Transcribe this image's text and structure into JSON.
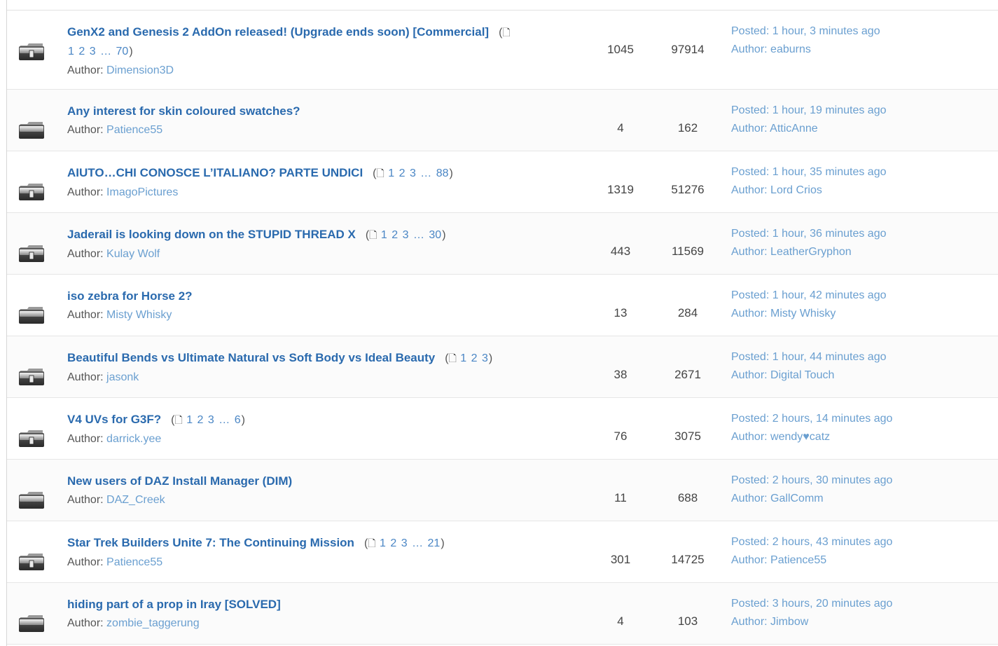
{
  "topics": [
    {
      "title": "GenX2 and Genesis 2 AddOn released! (Upgrade ends soon) [Commercial]",
      "pages": [
        "1",
        "2",
        "3",
        "…",
        "70"
      ],
      "author_label": "Author:",
      "author": "Dimension3D",
      "replies": "1045",
      "views": "97914",
      "posted_label": "Posted:",
      "posted": "1 hour, 3 minutes ago",
      "last_author_label": "Author:",
      "last_author": "eaburns",
      "icon": "folder-hot-icon"
    },
    {
      "title": "Any interest for skin coloured swatches?",
      "pages": [],
      "author_label": "Author:",
      "author": "Patience55",
      "replies": "4",
      "views": "162",
      "posted_label": "Posted:",
      "posted": "1 hour, 19 minutes ago",
      "last_author_label": "Author:",
      "last_author": "AtticAnne",
      "icon": "folder-icon"
    },
    {
      "title": "AIUTO…CHI CONOSCE L’ITALIANO? PARTE UNDICI",
      "pages": [
        "1",
        "2",
        "3",
        "…",
        "88"
      ],
      "author_label": "Author:",
      "author": "ImagoPictures",
      "replies": "1319",
      "views": "51276",
      "posted_label": "Posted:",
      "posted": "1 hour, 35 minutes ago",
      "last_author_label": "Author:",
      "last_author": "Lord Crios",
      "icon": "folder-hot-icon"
    },
    {
      "title": "Jaderail is looking down on the STUPID THREAD X",
      "pages": [
        "1",
        "2",
        "3",
        "…",
        "30"
      ],
      "author_label": "Author:",
      "author": "Kulay Wolf",
      "replies": "443",
      "views": "11569",
      "posted_label": "Posted:",
      "posted": "1 hour, 36 minutes ago",
      "last_author_label": "Author:",
      "last_author": "LeatherGryphon",
      "icon": "folder-hot-icon"
    },
    {
      "title": "iso zebra for Horse 2?",
      "pages": [],
      "author_label": "Author:",
      "author": "Misty Whisky",
      "replies": "13",
      "views": "284",
      "posted_label": "Posted:",
      "posted": "1 hour, 42 minutes ago",
      "last_author_label": "Author:",
      "last_author": "Misty Whisky",
      "icon": "folder-icon"
    },
    {
      "title": "Beautiful Bends vs Ultimate Natural vs Soft Body vs Ideal Beauty",
      "pages": [
        "1",
        "2",
        "3"
      ],
      "author_label": "Author:",
      "author": "jasonk",
      "replies": "38",
      "views": "2671",
      "posted_label": "Posted:",
      "posted": "1 hour, 44 minutes ago",
      "last_author_label": "Author:",
      "last_author": "Digital Touch",
      "icon": "folder-hot-icon"
    },
    {
      "title": "V4 UVs for G3F?",
      "pages": [
        "1",
        "2",
        "3",
        "…",
        "6"
      ],
      "author_label": "Author:",
      "author": "darrick.yee",
      "replies": "76",
      "views": "3075",
      "posted_label": "Posted:",
      "posted": "2 hours, 14 minutes ago",
      "last_author_label": "Author:",
      "last_author": "wendy♥catz",
      "icon": "folder-hot-icon"
    },
    {
      "title": "New users of DAZ Install Manager (DIM)",
      "pages": [],
      "author_label": "Author:",
      "author": "DAZ_Creek",
      "replies": "11",
      "views": "688",
      "posted_label": "Posted:",
      "posted": "2 hours, 30 minutes ago",
      "last_author_label": "Author:",
      "last_author": "GallComm",
      "icon": "folder-icon"
    },
    {
      "title": "Star Trek Builders Unite 7: The Continuing Mission",
      "pages": [
        "1",
        "2",
        "3",
        "…",
        "21"
      ],
      "author_label": "Author:",
      "author": "Patience55",
      "replies": "301",
      "views": "14725",
      "posted_label": "Posted:",
      "posted": "2 hours, 43 minutes ago",
      "last_author_label": "Author:",
      "last_author": "Patience55",
      "icon": "folder-hot-icon"
    },
    {
      "title": "hiding part of a prop in Iray [SOLVED]",
      "pages": [],
      "author_label": "Author:",
      "author": "zombie_taggerung",
      "replies": "4",
      "views": "103",
      "posted_label": "Posted:",
      "posted": "3 hours, 20 minutes ago",
      "last_author_label": "Author:",
      "last_author": "Jimbow",
      "icon": "folder-icon"
    }
  ],
  "pages_open": "(",
  "pages_close": ")",
  "pages_icon": "page-icon",
  "colors": {
    "link": "#2a6aae",
    "meta_link": "#6a9fd0",
    "text": "#555555"
  }
}
